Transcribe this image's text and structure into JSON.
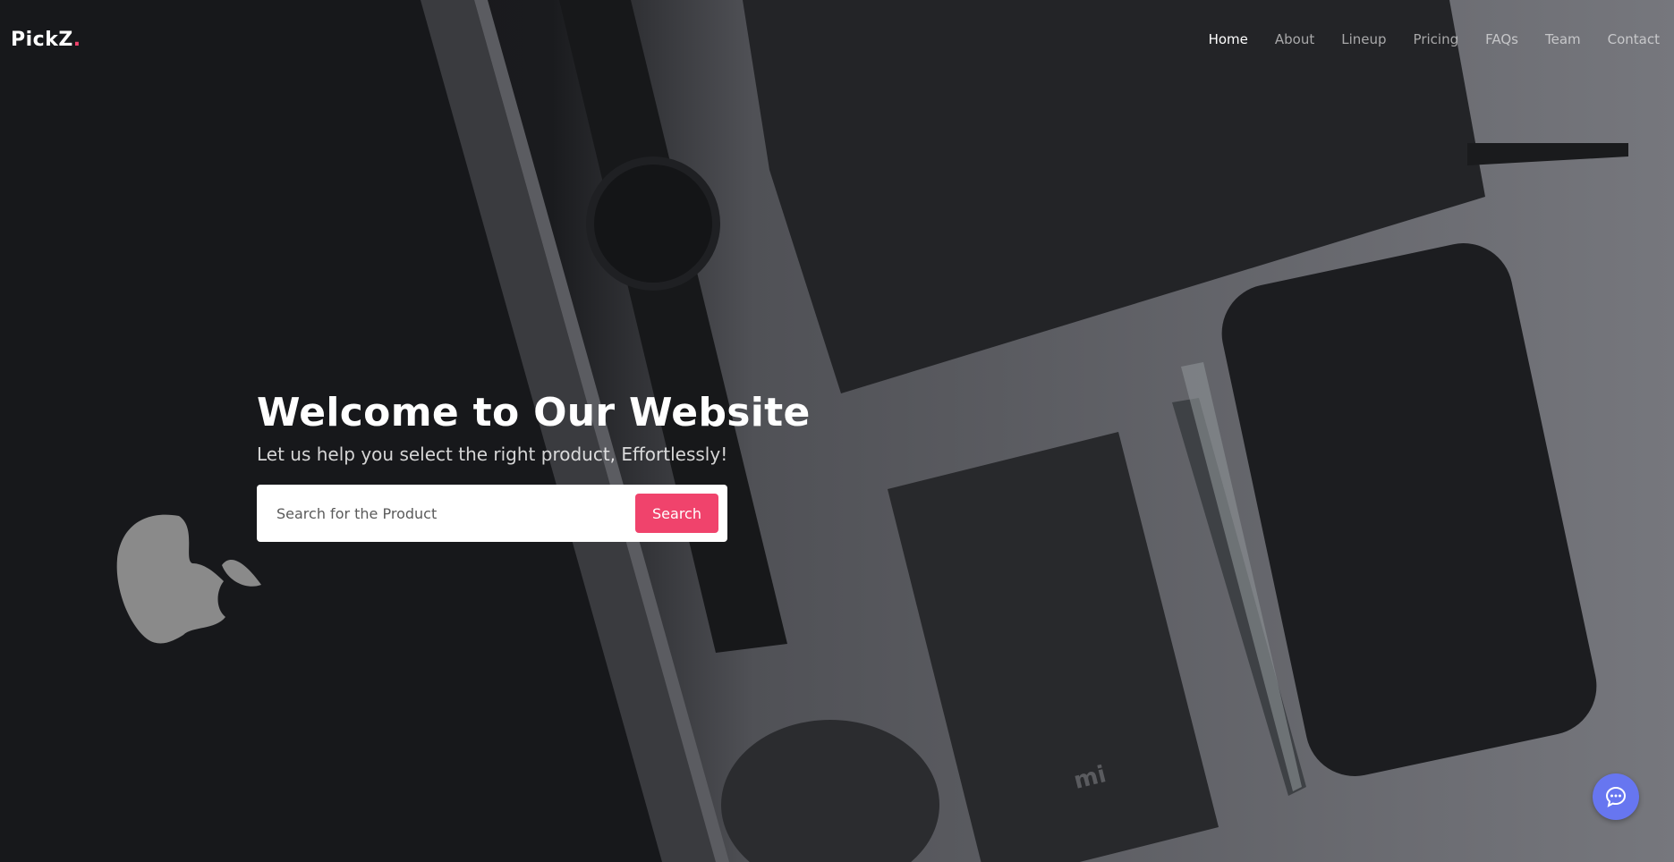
{
  "brand": {
    "name": "PickZ",
    "dot": ".",
    "accent_color": "#f0436c"
  },
  "nav": {
    "items": [
      {
        "label": "Home",
        "active": true
      },
      {
        "label": "About",
        "active": false
      },
      {
        "label": "Lineup",
        "active": false
      },
      {
        "label": "Pricing",
        "active": false
      },
      {
        "label": "FAQs",
        "active": false
      },
      {
        "label": "Team",
        "active": false
      },
      {
        "label": "Contact",
        "active": false
      }
    ]
  },
  "hero": {
    "title": "Welcome to Our Website",
    "subtitle": "Let us help you select the right product, Effortlessly!",
    "search": {
      "placeholder": "Search for the Product",
      "button_label": "Search",
      "button_color": "#f0436c"
    }
  },
  "chat": {
    "icon": "chat-bubble-icon",
    "color": "#6776f0"
  }
}
